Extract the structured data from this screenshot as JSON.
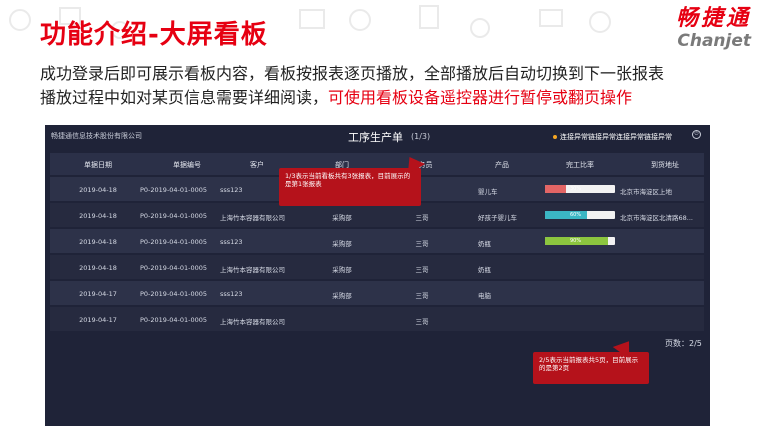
{
  "slide": {
    "title": "功能介绍-大屏看板",
    "logo_cn": "畅捷通",
    "logo_en": "Chanjet",
    "desc_line1": "成功登录后即可展示看板内容，看板按报表逐页播放，全部播放后自动切换到下一张报表",
    "desc_line2_plain": "播放过程中如对某页信息需要详细阅读，",
    "desc_line2_highlight": "可使用看板设备遥控器进行暂停或翻页操作",
    "highlight_color": "#e60012"
  },
  "board": {
    "company": "畅捷通信息技术股份有限公司",
    "title": "工序生产单",
    "page": "(1/3)",
    "alert_text": "连接异常链接异常连接异常链接异常",
    "control_icon": "power-icon",
    "columns": [
      "单据日期",
      "单据编号",
      "客户",
      "部门",
      "业务员",
      "产品",
      "完工比率",
      "到货地址"
    ],
    "rows": [
      {
        "date": "2019-04-18",
        "code": "P0-2019-04-01-0005",
        "customer": "sss123",
        "dept": "",
        "staff": "",
        "product": "婴儿车",
        "ratio_label": "30%",
        "ratio": 0.3,
        "bar_color": "#e36565",
        "address": "北京市海淀区上地"
      },
      {
        "date": "2019-04-18",
        "code": "P0-2019-04-01-0005",
        "customer": "上海竹本容器有限公司",
        "dept": "采购部",
        "staff": "三哥",
        "product": "好孩子婴儿车",
        "ratio_label": "60%",
        "ratio": 0.6,
        "bar_color": "#3bb6c4",
        "address": "北京市海淀区北清路68..."
      },
      {
        "date": "2019-04-18",
        "code": "P0-2019-04-01-0005",
        "customer": "sss123",
        "dept": "采购部",
        "staff": "三哥",
        "product": "奶瓶",
        "ratio_label": "90%",
        "ratio": 0.9,
        "bar_color": "#8cc63f",
        "address": ""
      },
      {
        "date": "2019-04-18",
        "code": "P0-2019-04-01-0005",
        "customer": "上海竹本容器有限公司",
        "dept": "采购部",
        "staff": "三哥",
        "product": "奶瓶",
        "ratio_label": "",
        "ratio": null,
        "bar_color": "",
        "address": ""
      },
      {
        "date": "2019-04-17",
        "code": "P0-2019-04-01-0005",
        "customer": "sss123",
        "dept": "采购部",
        "staff": "三哥",
        "product": "电脑",
        "ratio_label": "",
        "ratio": null,
        "bar_color": "",
        "address": ""
      },
      {
        "date": "2019-04-17",
        "code": "P0-2019-04-01-0005",
        "customer": "上海竹本容器有限公司",
        "dept": "",
        "staff": "三哥",
        "product": "",
        "ratio_label": "",
        "ratio": null,
        "bar_color": "",
        "address": ""
      }
    ],
    "pager": "页数：2/5"
  },
  "callouts": {
    "first": "1/3表示当前看板共有3张报表，目前展示的是第1张报表",
    "second": "2/5表示当前报表共5页，目前展示的是第2页"
  }
}
